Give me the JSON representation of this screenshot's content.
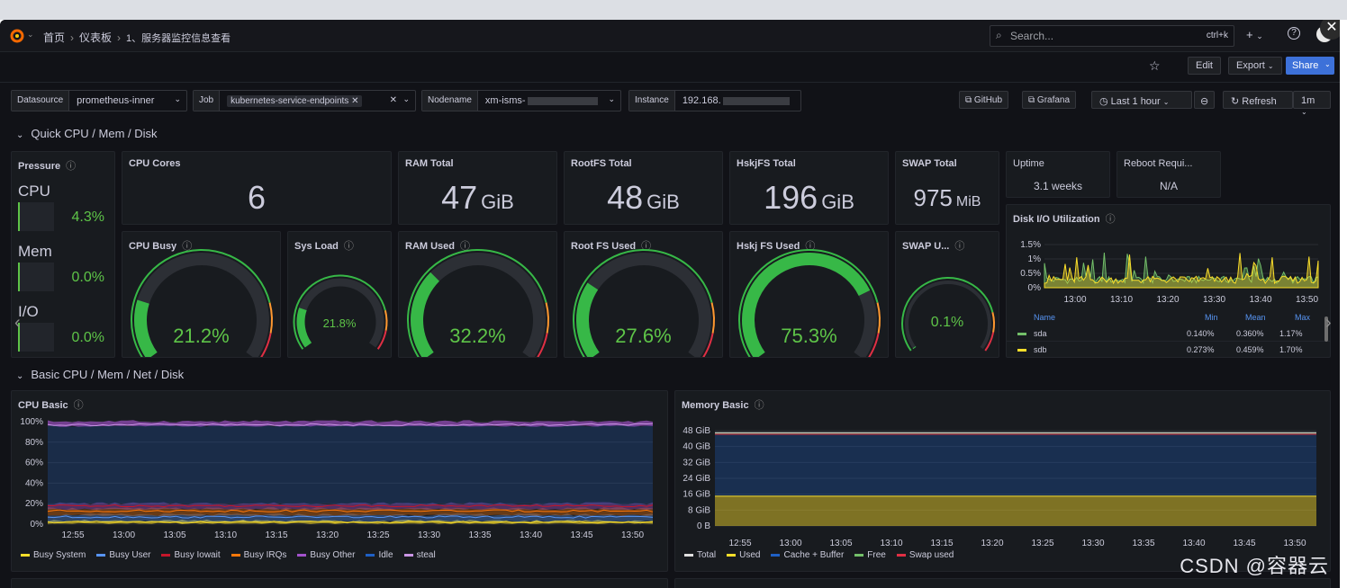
{
  "breadcrumb": {
    "home": "首页",
    "dashboards": "仪表板",
    "current": "1、服务器监控信息查看"
  },
  "search": {
    "placeholder": "Search...",
    "shortcut": "ctrl+k"
  },
  "toolbar": {
    "edit": "Edit",
    "export": "Export",
    "share": "Share"
  },
  "variables": {
    "datasource": {
      "label": "Datasource",
      "value": "prometheus-inner"
    },
    "job": {
      "label": "Job",
      "value": "kubernetes-service-endpoints"
    },
    "nodename": {
      "label": "Nodename",
      "value": "xm-isms-"
    },
    "instance": {
      "label": "Instance",
      "value": "192.168."
    }
  },
  "links": {
    "github": "GitHub",
    "grafana": "Grafana"
  },
  "timepicker": {
    "range": "Last 1 hour",
    "refresh": "Refresh",
    "interval": "1m"
  },
  "rows": {
    "quick": "Quick CPU / Mem / Disk",
    "basic": "Basic CPU / Mem / Net / Disk"
  },
  "pressure": {
    "title": "Pressure",
    "items": [
      {
        "name": "CPU",
        "value": "4.3%"
      },
      {
        "name": "Mem",
        "value": "0.0%"
      },
      {
        "name": "I/O",
        "value": "0.0%"
      }
    ]
  },
  "stats": {
    "cpu_cores": {
      "title": "CPU Cores",
      "value": "6",
      "unit": ""
    },
    "ram_total": {
      "title": "RAM Total",
      "value": "47",
      "unit": "GiB"
    },
    "rootfs_total": {
      "title": "RootFS Total",
      "value": "48",
      "unit": "GiB"
    },
    "hskjfs_total": {
      "title": "HskjFS Total",
      "value": "196",
      "unit": "GiB"
    },
    "swap_total": {
      "title": "SWAP Total",
      "value": "975",
      "unit": "MiB"
    },
    "uptime": {
      "title": "Uptime",
      "value": "3.1 weeks"
    },
    "reboot": {
      "title": "Reboot Requi...",
      "value": "N/A"
    }
  },
  "gauges": {
    "cpu_busy": {
      "title": "CPU Busy",
      "value": "21.2%",
      "level": 0.212
    },
    "sys_load": {
      "title": "Sys Load",
      "value": "21.8%",
      "level": 0.218
    },
    "ram_used": {
      "title": "RAM Used",
      "value": "32.2%",
      "level": 0.322
    },
    "rootfs_used": {
      "title": "Root FS Used",
      "value": "27.6%",
      "level": 0.276
    },
    "hskjfs_used": {
      "title": "Hskj FS Used",
      "value": "75.3%",
      "level": 0.753
    },
    "swap_used": {
      "title": "SWAP U...",
      "value": "0.1%",
      "level": 0.001
    }
  },
  "disk_io": {
    "title": "Disk I/O Utilization",
    "yticks": [
      "1.5%",
      "1%",
      "0.5%",
      "0%"
    ],
    "xticks": [
      "13:00",
      "13:10",
      "13:20",
      "13:30",
      "13:40",
      "13:50"
    ],
    "headers": {
      "name": "Name",
      "min": "Min",
      "mean": "Mean",
      "max": "Max"
    },
    "rows": [
      {
        "name": "sda",
        "min": "0.140%",
        "mean": "0.360%",
        "max": "1.17%",
        "color": "#73bf69"
      },
      {
        "name": "sdb",
        "min": "0.273%",
        "mean": "0.459%",
        "max": "1.70%",
        "color": "#fade2a"
      }
    ]
  },
  "cpu_basic": {
    "title": "CPU Basic",
    "yticks": [
      "100%",
      "80%",
      "60%",
      "40%",
      "20%",
      "0%"
    ],
    "xticks": [
      "12:55",
      "13:00",
      "13:05",
      "13:10",
      "13:15",
      "13:20",
      "13:25",
      "13:30",
      "13:35",
      "13:40",
      "13:45",
      "13:50"
    ],
    "legend": [
      {
        "name": "Busy System",
        "color": "#fade2a"
      },
      {
        "name": "Busy User",
        "color": "#5794f2"
      },
      {
        "name": "Busy Iowait",
        "color": "#c4162a"
      },
      {
        "name": "Busy IRQs",
        "color": "#ff780a"
      },
      {
        "name": "Busy Other",
        "color": "#a352cc"
      },
      {
        "name": "Idle",
        "color": "#1f60c4"
      },
      {
        "name": "steal",
        "color": "#ca95e5"
      }
    ]
  },
  "memory_basic": {
    "title": "Memory Basic",
    "yticks": [
      "48 GiB",
      "40 GiB",
      "32 GiB",
      "24 GiB",
      "16 GiB",
      "8 GiB",
      "0 B"
    ],
    "xticks": [
      "12:55",
      "13:00",
      "13:05",
      "13:10",
      "13:15",
      "13:20",
      "13:25",
      "13:30",
      "13:35",
      "13:40",
      "13:45",
      "13:50"
    ],
    "legend": [
      {
        "name": "Total",
        "color": "#e0e0e0"
      },
      {
        "name": "Used",
        "color": "#fade2a"
      },
      {
        "name": "Cache + Buffer",
        "color": "#1f60c4"
      },
      {
        "name": "Free",
        "color": "#73bf69"
      },
      {
        "name": "Swap used",
        "color": "#e02f44"
      }
    ]
  },
  "watermark": "CSDN @容器云"
}
